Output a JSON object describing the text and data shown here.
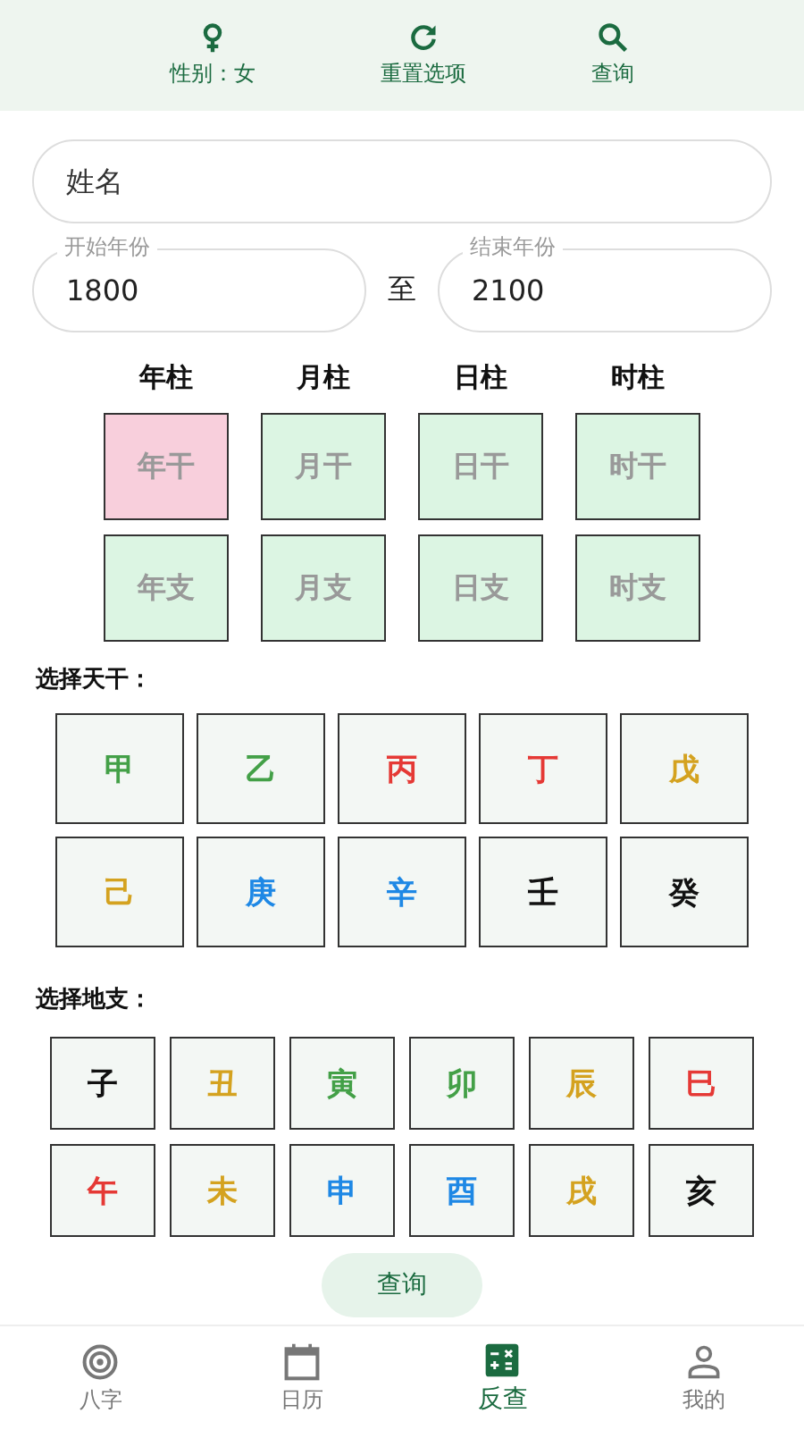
{
  "toolbar": [
    {
      "label": "性别：女"
    },
    {
      "label": "重置选项"
    },
    {
      "label": "查询"
    }
  ],
  "name_field": {
    "placeholder": "姓名"
  },
  "year_range": {
    "start": {
      "label": "开始年份",
      "value": "1800"
    },
    "separator": "至",
    "end": {
      "label": "结束年份",
      "value": "2100"
    }
  },
  "pillars": [
    {
      "header": "年柱",
      "cells": [
        {
          "label": "年干",
          "selected": true
        },
        {
          "label": "年支",
          "selected": false
        }
      ]
    },
    {
      "header": "月柱",
      "cells": [
        {
          "label": "月干",
          "selected": false
        },
        {
          "label": "月支",
          "selected": false
        }
      ]
    },
    {
      "header": "日柱",
      "cells": [
        {
          "label": "日干",
          "selected": false
        },
        {
          "label": "日支",
          "selected": false
        }
      ]
    },
    {
      "header": "时柱",
      "cells": [
        {
          "label": "时干",
          "selected": false
        },
        {
          "label": "时支",
          "selected": false
        }
      ]
    }
  ],
  "tiangan": {
    "title": "选择天干：",
    "items": [
      {
        "label": "甲",
        "color": "#43a047"
      },
      {
        "label": "乙",
        "color": "#43a047"
      },
      {
        "label": "丙",
        "color": "#e53935"
      },
      {
        "label": "丁",
        "color": "#e53935"
      },
      {
        "label": "戊",
        "color": "#d4a21f"
      },
      {
        "label": "己",
        "color": "#d4a21f"
      },
      {
        "label": "庚",
        "color": "#1e88e5"
      },
      {
        "label": "辛",
        "color": "#1e88e5"
      },
      {
        "label": "壬",
        "color": "#111111"
      },
      {
        "label": "癸",
        "color": "#111111"
      }
    ]
  },
  "dizhi": {
    "title": "选择地支：",
    "items": [
      {
        "label": "子",
        "color": "#111111"
      },
      {
        "label": "丑",
        "color": "#d4a21f"
      },
      {
        "label": "寅",
        "color": "#43a047"
      },
      {
        "label": "卯",
        "color": "#43a047"
      },
      {
        "label": "辰",
        "color": "#d4a21f"
      },
      {
        "label": "巳",
        "color": "#e53935"
      },
      {
        "label": "午",
        "color": "#e53935"
      },
      {
        "label": "未",
        "color": "#d4a21f"
      },
      {
        "label": "申",
        "color": "#1e88e5"
      },
      {
        "label": "酉",
        "color": "#1e88e5"
      },
      {
        "label": "戌",
        "color": "#d4a21f"
      },
      {
        "label": "亥",
        "color": "#111111"
      }
    ]
  },
  "query_button": {
    "label": "查询"
  },
  "bottom_nav": [
    {
      "label": "八字",
      "selected": false
    },
    {
      "label": "日历",
      "selected": false
    },
    {
      "label": "反查",
      "selected": true
    },
    {
      "label": "我的",
      "selected": false
    }
  ]
}
